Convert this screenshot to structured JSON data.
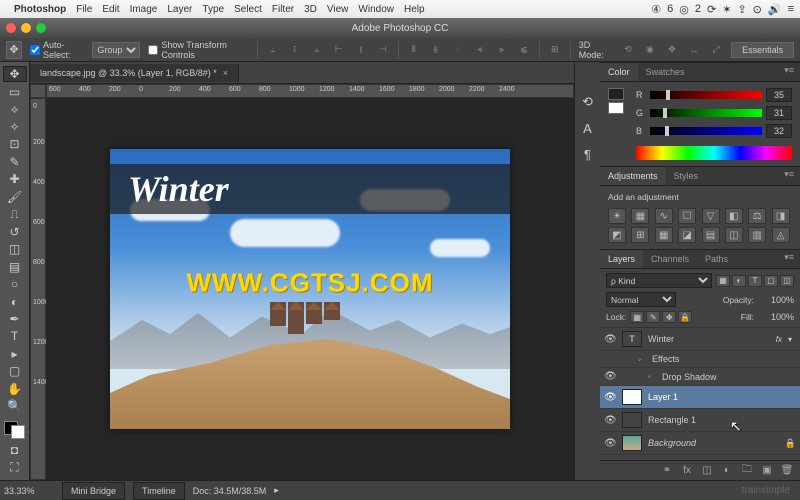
{
  "mac_menubar": {
    "app": "Photoshop",
    "items": [
      "File",
      "Edit",
      "Image",
      "Layer",
      "Type",
      "Select",
      "Filter",
      "3D",
      "View",
      "Window",
      "Help"
    ],
    "status_icons": [
      "④",
      "6",
      "◎",
      "2",
      "⟳",
      "✶",
      "⇪",
      "⊙",
      "🔊",
      "≡"
    ]
  },
  "window": {
    "title": "Adobe Photoshop CC"
  },
  "options_bar": {
    "auto_select_label": "Auto-Select:",
    "auto_select_value": "Group",
    "show_transform_label": "Show Transform Controls",
    "mode_label": "3D Mode:",
    "workspace": "Essentials"
  },
  "doc_tab": {
    "label": "landscape.jpg @ 33.3% (Layer 1, RGB/8#) *"
  },
  "ruler_h": [
    "600",
    "400",
    "200",
    "0",
    "200",
    "400",
    "600",
    "800",
    "1000",
    "1200",
    "1400",
    "1600",
    "1800",
    "2000",
    "2200",
    "2400"
  ],
  "ruler_v": [
    "0",
    "200",
    "400",
    "600",
    "800",
    "1000",
    "1200",
    "1400"
  ],
  "canvas": {
    "winter_text": "Winter",
    "watermark": "WWW.CGTSJ.COM"
  },
  "color_panel": {
    "tabs": [
      "Color",
      "Swatches"
    ],
    "channels": [
      {
        "label": "R",
        "value": "35"
      },
      {
        "label": "G",
        "value": "31"
      },
      {
        "label": "B",
        "value": "32"
      }
    ]
  },
  "adjustments_panel": {
    "tabs": [
      "Adjustments",
      "Styles"
    ],
    "heading": "Add an adjustment"
  },
  "layers_panel": {
    "tabs": [
      "Layers",
      "Channels",
      "Paths"
    ],
    "kind_label": "ρ Kind",
    "blend_mode": "Normal",
    "opacity_label": "Opacity:",
    "opacity_value": "100%",
    "lock_label": "Lock:",
    "fill_label": "Fill:",
    "fill_value": "100%",
    "layers": [
      {
        "name": "Winter",
        "type": "text",
        "visible": true,
        "fx": true
      },
      {
        "name": "Effects",
        "type": "fx-group",
        "indent": 1
      },
      {
        "name": "Drop Shadow",
        "type": "fx-item",
        "indent": 2,
        "visible": true
      },
      {
        "name": "Layer 1",
        "type": "raster",
        "visible": true,
        "selected": true
      },
      {
        "name": "Rectangle 1",
        "type": "shape",
        "visible": true
      },
      {
        "name": "Background",
        "type": "background",
        "visible": true,
        "locked": true
      }
    ]
  },
  "status_bar": {
    "zoom": "33.33%",
    "tabs": [
      "Mini Bridge",
      "Timeline"
    ],
    "doc_info": "Doc: 34.5M/38.5M",
    "brand": "trainsimple"
  }
}
